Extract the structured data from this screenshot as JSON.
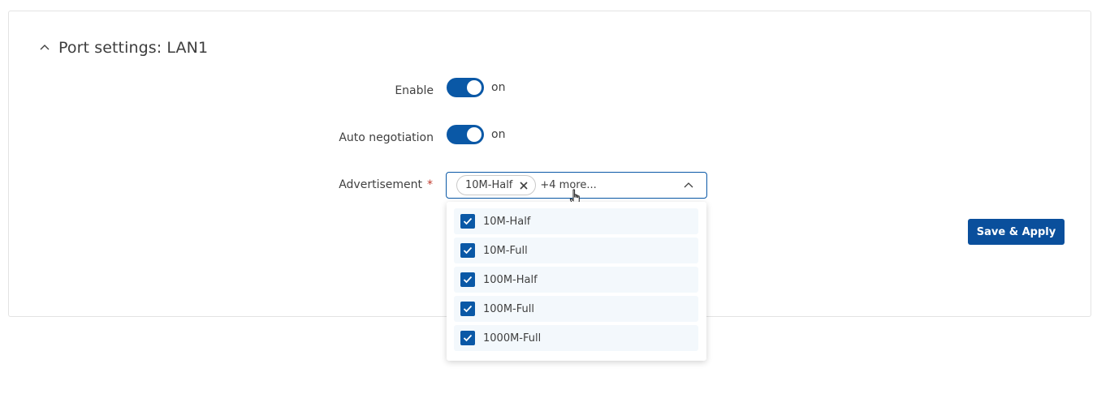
{
  "section": {
    "title": "Port settings: LAN1"
  },
  "form": {
    "enable": {
      "label": "Enable",
      "state_text": "on"
    },
    "auto_negotiation": {
      "label": "Auto negotiation",
      "state_text": "on"
    },
    "advertisement": {
      "label": "Advertisement",
      "required_mark": "*",
      "selected_chip": "10M-Half",
      "more_text": "+4 more...",
      "options": [
        {
          "label": "10M-Half",
          "checked": true
        },
        {
          "label": "10M-Full",
          "checked": true
        },
        {
          "label": "100M-Half",
          "checked": true
        },
        {
          "label": "100M-Full",
          "checked": true
        },
        {
          "label": "1000M-Full",
          "checked": true
        }
      ]
    }
  },
  "actions": {
    "save_label": "Save & Apply"
  },
  "colors": {
    "accent": "#0a58a6",
    "button": "#0a4f9c",
    "option_bg": "#f3f8fc",
    "required": "#c0392b"
  }
}
